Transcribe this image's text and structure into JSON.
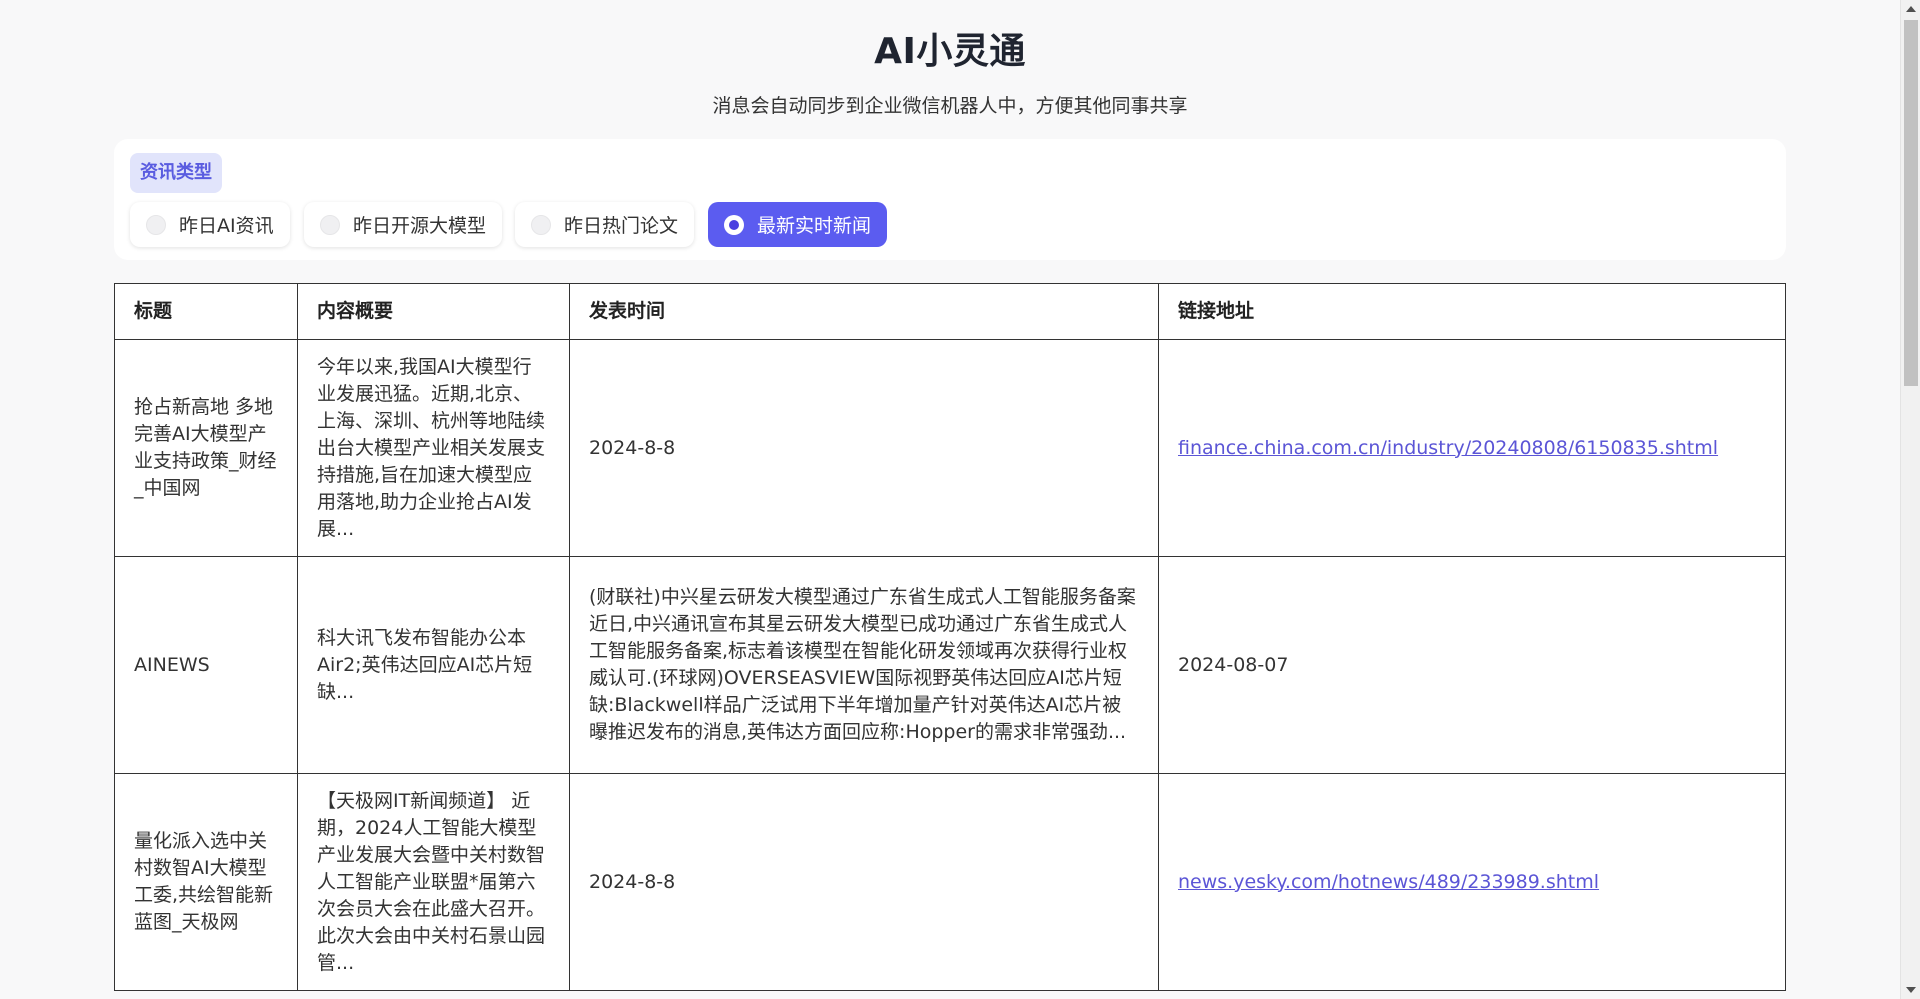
{
  "header": {
    "title": "AI小灵通",
    "subtitle": "消息会自动同步到企业微信机器人中，方便其他同事共享"
  },
  "filter": {
    "label": "资讯类型",
    "options": [
      {
        "label": "昨日AI资讯",
        "selected": false
      },
      {
        "label": "昨日开源大模型",
        "selected": false
      },
      {
        "label": "昨日热门论文",
        "selected": false
      },
      {
        "label": "最新实时新闻",
        "selected": true
      }
    ]
  },
  "table": {
    "headers": [
      "标题",
      "内容概要",
      "发表时间",
      "链接地址"
    ],
    "rows": [
      {
        "title": "抢占新高地 多地完善AI大模型产业支持政策_财经_中国网",
        "summary": "今年以来,我国AI大模型行业发展迅猛。近期,北京、上海、深圳、杭州等地陆续出台大模型产业相关发展支持措施,旨在加速大模型应用落地,助力企业抢占AI发展...",
        "time": "2024-8-8",
        "link": "finance.china.com.cn/industry/20240808/6150835.shtml"
      },
      {
        "title": "AINEWS",
        "summary": "科大讯飞发布智能办公本Air2;英伟达回应AI芯片短缺...",
        "time": "(财联社)中兴星云研发大模型通过广东省生成式人工智能服务备案近日,中兴通讯宣布其星云研发大模型已成功通过广东省生成式人工智能服务备案,标志着该模型在智能化研发领域再次获得行业权威认可.(环球网)OVERSEASVIEW国际视野英伟达回应AI芯片短缺:Blackwell样品广泛试用下半年增加量产针对英伟达AI芯片被曝推迟发布的消息,英伟达方面回应称:Hopper的需求非常强劲...",
        "link": "2024-08-07"
      },
      {
        "title": "量化派入选中关村数智AI大模型工委,共绘智能新蓝图_天极网",
        "summary": "【天极网IT新闻频道】 近期，2024人工智能大模型产业发展大会暨中关村数智人工智能产业联盟*届第六次会员大会在此盛大召开。此次大会由中关村石景山园管...",
        "time": "2024-8-8",
        "link": "news.yesky.com/hotnews/489/233989.shtml"
      }
    ]
  }
}
